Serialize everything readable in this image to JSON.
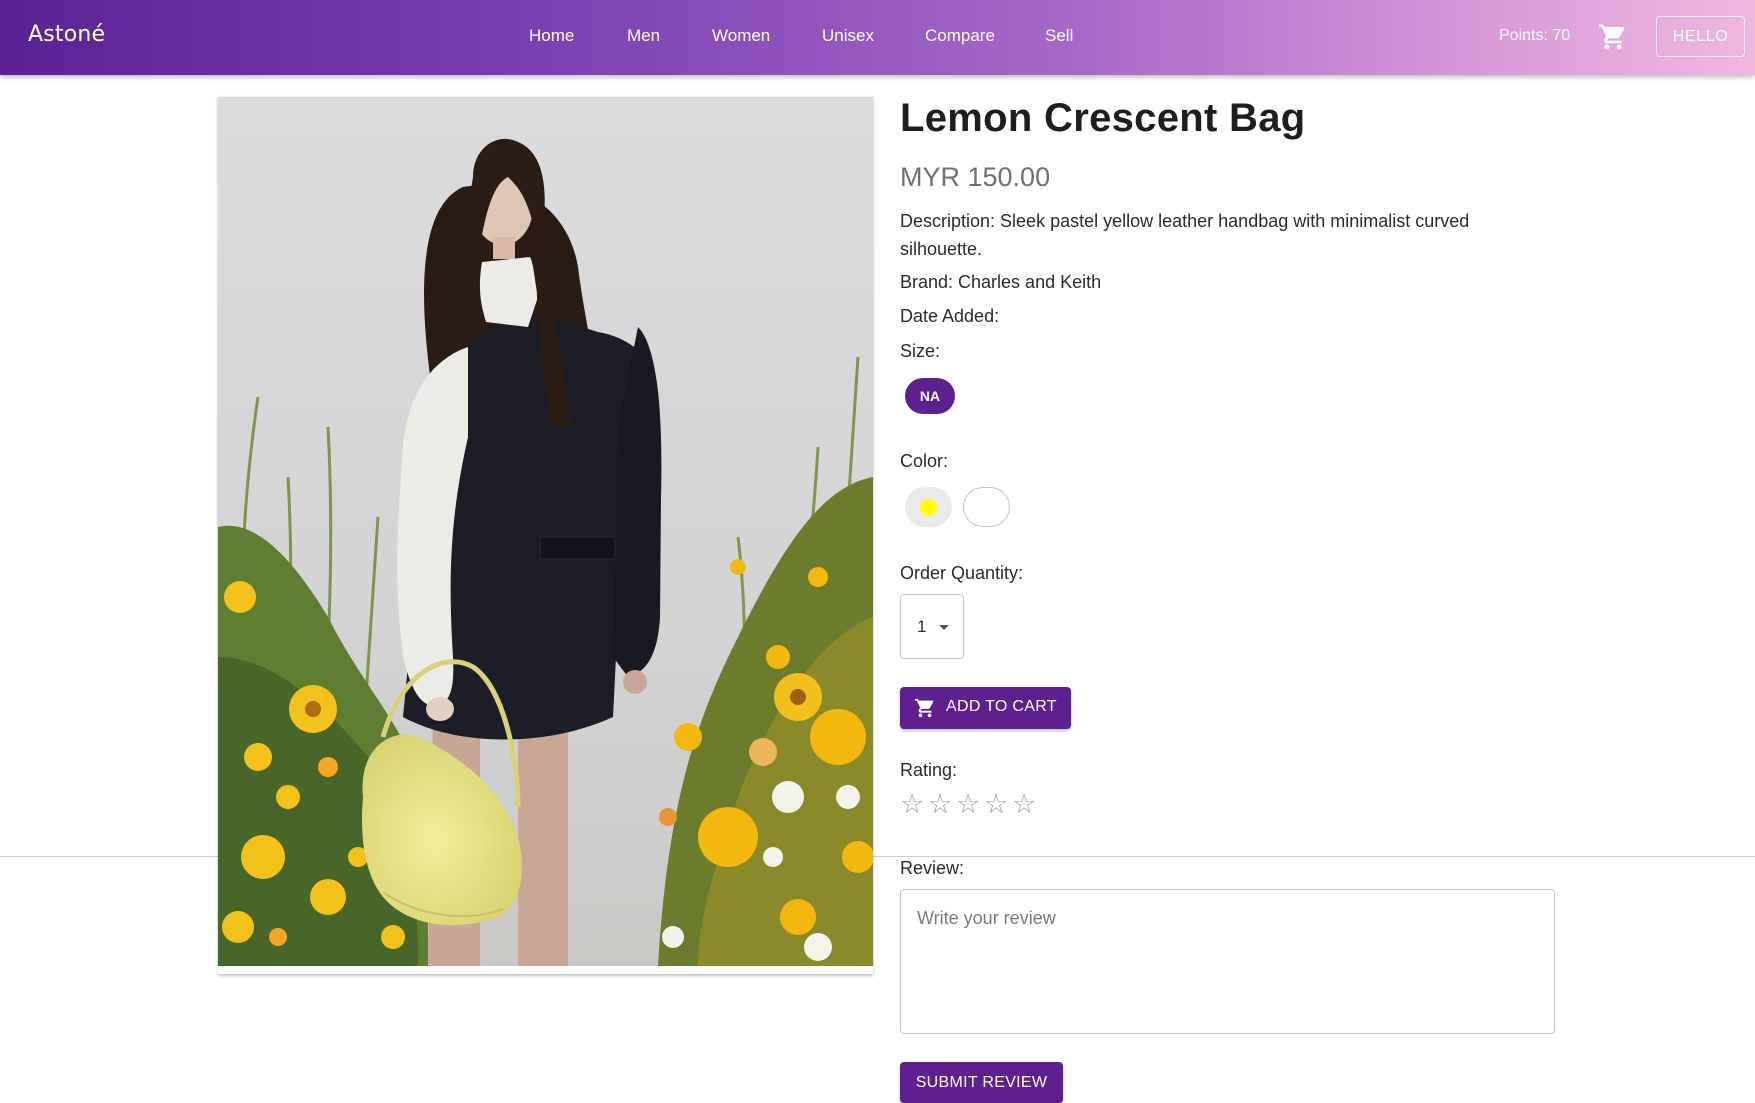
{
  "appbar": {
    "brand": "Astoné",
    "nav": [
      {
        "label": "Home"
      },
      {
        "label": "Men"
      },
      {
        "label": "Women"
      },
      {
        "label": "Unisex"
      },
      {
        "label": "Compare"
      },
      {
        "label": "Sell"
      }
    ],
    "points": "Points: 70",
    "cart_icon": "shopping-cart-icon",
    "account_button": "HELLO"
  },
  "product": {
    "image_icon": "product-photo",
    "title": "Lemon Crescent Bag",
    "price": "MYR 150.00",
    "description": "Description: Sleek pastel yellow leather handbag with minimalist curved silhouette.",
    "brand": "Brand: Charles and Keith",
    "date_added": "Date Added:",
    "size_label": "Size:",
    "sizes": [
      {
        "label": "NA",
        "selected": true
      }
    ],
    "color_label": "Color:",
    "colors": [
      {
        "value": "#ffff00",
        "selected": true
      },
      {
        "value": "#ffffff",
        "selected": false
      }
    ],
    "quantity_label": "Order Quantity:",
    "quantity_value": "1",
    "add_to_cart": "ADD TO CART",
    "rating_label": "Rating:",
    "rating_value": 0,
    "rating_max": 5,
    "star_glyph": "☆",
    "review_label": "Review:",
    "review_placeholder": "Write your review",
    "submit_review": "SUBMIT REVIEW"
  },
  "theme": {
    "primary": "#5e1f8f",
    "header_gradient_start": "#5b2195",
    "header_gradient_end": "#f0b8df"
  }
}
